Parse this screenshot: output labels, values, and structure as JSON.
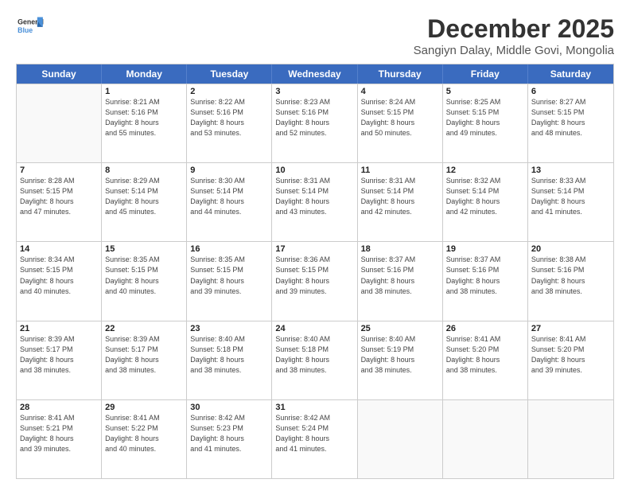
{
  "logo": {
    "line1": "General",
    "line2": "Blue"
  },
  "title": "December 2025",
  "subtitle": "Sangiyn Dalay, Middle Govi, Mongolia",
  "header_days": [
    "Sunday",
    "Monday",
    "Tuesday",
    "Wednesday",
    "Thursday",
    "Friday",
    "Saturday"
  ],
  "weeks": [
    [
      {
        "day": "",
        "sunrise": "",
        "sunset": "",
        "daylight": ""
      },
      {
        "day": "1",
        "sunrise": "Sunrise: 8:21 AM",
        "sunset": "Sunset: 5:16 PM",
        "daylight": "Daylight: 8 hours",
        "daylight2": "and 55 minutes."
      },
      {
        "day": "2",
        "sunrise": "Sunrise: 8:22 AM",
        "sunset": "Sunset: 5:16 PM",
        "daylight": "Daylight: 8 hours",
        "daylight2": "and 53 minutes."
      },
      {
        "day": "3",
        "sunrise": "Sunrise: 8:23 AM",
        "sunset": "Sunset: 5:16 PM",
        "daylight": "Daylight: 8 hours",
        "daylight2": "and 52 minutes."
      },
      {
        "day": "4",
        "sunrise": "Sunrise: 8:24 AM",
        "sunset": "Sunset: 5:15 PM",
        "daylight": "Daylight: 8 hours",
        "daylight2": "and 50 minutes."
      },
      {
        "day": "5",
        "sunrise": "Sunrise: 8:25 AM",
        "sunset": "Sunset: 5:15 PM",
        "daylight": "Daylight: 8 hours",
        "daylight2": "and 49 minutes."
      },
      {
        "day": "6",
        "sunrise": "Sunrise: 8:27 AM",
        "sunset": "Sunset: 5:15 PM",
        "daylight": "Daylight: 8 hours",
        "daylight2": "and 48 minutes."
      }
    ],
    [
      {
        "day": "7",
        "sunrise": "Sunrise: 8:28 AM",
        "sunset": "Sunset: 5:15 PM",
        "daylight": "Daylight: 8 hours",
        "daylight2": "and 47 minutes."
      },
      {
        "day": "8",
        "sunrise": "Sunrise: 8:29 AM",
        "sunset": "Sunset: 5:14 PM",
        "daylight": "Daylight: 8 hours",
        "daylight2": "and 45 minutes."
      },
      {
        "day": "9",
        "sunrise": "Sunrise: 8:30 AM",
        "sunset": "Sunset: 5:14 PM",
        "daylight": "Daylight: 8 hours",
        "daylight2": "and 44 minutes."
      },
      {
        "day": "10",
        "sunrise": "Sunrise: 8:31 AM",
        "sunset": "Sunset: 5:14 PM",
        "daylight": "Daylight: 8 hours",
        "daylight2": "and 43 minutes."
      },
      {
        "day": "11",
        "sunrise": "Sunrise: 8:31 AM",
        "sunset": "Sunset: 5:14 PM",
        "daylight": "Daylight: 8 hours",
        "daylight2": "and 42 minutes."
      },
      {
        "day": "12",
        "sunrise": "Sunrise: 8:32 AM",
        "sunset": "Sunset: 5:14 PM",
        "daylight": "Daylight: 8 hours",
        "daylight2": "and 42 minutes."
      },
      {
        "day": "13",
        "sunrise": "Sunrise: 8:33 AM",
        "sunset": "Sunset: 5:14 PM",
        "daylight": "Daylight: 8 hours",
        "daylight2": "and 41 minutes."
      }
    ],
    [
      {
        "day": "14",
        "sunrise": "Sunrise: 8:34 AM",
        "sunset": "Sunset: 5:15 PM",
        "daylight": "Daylight: 8 hours",
        "daylight2": "and 40 minutes."
      },
      {
        "day": "15",
        "sunrise": "Sunrise: 8:35 AM",
        "sunset": "Sunset: 5:15 PM",
        "daylight": "Daylight: 8 hours",
        "daylight2": "and 40 minutes."
      },
      {
        "day": "16",
        "sunrise": "Sunrise: 8:35 AM",
        "sunset": "Sunset: 5:15 PM",
        "daylight": "Daylight: 8 hours",
        "daylight2": "and 39 minutes."
      },
      {
        "day": "17",
        "sunrise": "Sunrise: 8:36 AM",
        "sunset": "Sunset: 5:15 PM",
        "daylight": "Daylight: 8 hours",
        "daylight2": "and 39 minutes."
      },
      {
        "day": "18",
        "sunrise": "Sunrise: 8:37 AM",
        "sunset": "Sunset: 5:16 PM",
        "daylight": "Daylight: 8 hours",
        "daylight2": "and 38 minutes."
      },
      {
        "day": "19",
        "sunrise": "Sunrise: 8:37 AM",
        "sunset": "Sunset: 5:16 PM",
        "daylight": "Daylight: 8 hours",
        "daylight2": "and 38 minutes."
      },
      {
        "day": "20",
        "sunrise": "Sunrise: 8:38 AM",
        "sunset": "Sunset: 5:16 PM",
        "daylight": "Daylight: 8 hours",
        "daylight2": "and 38 minutes."
      }
    ],
    [
      {
        "day": "21",
        "sunrise": "Sunrise: 8:39 AM",
        "sunset": "Sunset: 5:17 PM",
        "daylight": "Daylight: 8 hours",
        "daylight2": "and 38 minutes."
      },
      {
        "day": "22",
        "sunrise": "Sunrise: 8:39 AM",
        "sunset": "Sunset: 5:17 PM",
        "daylight": "Daylight: 8 hours",
        "daylight2": "and 38 minutes."
      },
      {
        "day": "23",
        "sunrise": "Sunrise: 8:40 AM",
        "sunset": "Sunset: 5:18 PM",
        "daylight": "Daylight: 8 hours",
        "daylight2": "and 38 minutes."
      },
      {
        "day": "24",
        "sunrise": "Sunrise: 8:40 AM",
        "sunset": "Sunset: 5:18 PM",
        "daylight": "Daylight: 8 hours",
        "daylight2": "and 38 minutes."
      },
      {
        "day": "25",
        "sunrise": "Sunrise: 8:40 AM",
        "sunset": "Sunset: 5:19 PM",
        "daylight": "Daylight: 8 hours",
        "daylight2": "and 38 minutes."
      },
      {
        "day": "26",
        "sunrise": "Sunrise: 8:41 AM",
        "sunset": "Sunset: 5:20 PM",
        "daylight": "Daylight: 8 hours",
        "daylight2": "and 38 minutes."
      },
      {
        "day": "27",
        "sunrise": "Sunrise: 8:41 AM",
        "sunset": "Sunset: 5:20 PM",
        "daylight": "Daylight: 8 hours",
        "daylight2": "and 39 minutes."
      }
    ],
    [
      {
        "day": "28",
        "sunrise": "Sunrise: 8:41 AM",
        "sunset": "Sunset: 5:21 PM",
        "daylight": "Daylight: 8 hours",
        "daylight2": "and 39 minutes."
      },
      {
        "day": "29",
        "sunrise": "Sunrise: 8:41 AM",
        "sunset": "Sunset: 5:22 PM",
        "daylight": "Daylight: 8 hours",
        "daylight2": "and 40 minutes."
      },
      {
        "day": "30",
        "sunrise": "Sunrise: 8:42 AM",
        "sunset": "Sunset: 5:23 PM",
        "daylight": "Daylight: 8 hours",
        "daylight2": "and 41 minutes."
      },
      {
        "day": "31",
        "sunrise": "Sunrise: 8:42 AM",
        "sunset": "Sunset: 5:24 PM",
        "daylight": "Daylight: 8 hours",
        "daylight2": "and 41 minutes."
      },
      {
        "day": "",
        "sunrise": "",
        "sunset": "",
        "daylight": ""
      },
      {
        "day": "",
        "sunrise": "",
        "sunset": "",
        "daylight": ""
      },
      {
        "day": "",
        "sunrise": "",
        "sunset": "",
        "daylight": ""
      }
    ]
  ]
}
